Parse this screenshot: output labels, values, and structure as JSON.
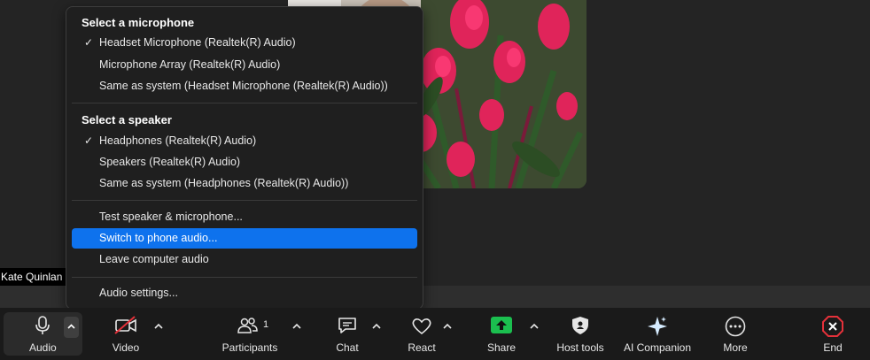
{
  "meeting": {
    "participant_name": "Kate Quinlan"
  },
  "audio_menu": {
    "microphone_header": "Select a microphone",
    "microphones": [
      {
        "label": "Headset Microphone (Realtek(R) Audio)",
        "checked": true
      },
      {
        "label": "Microphone Array (Realtek(R) Audio)",
        "checked": false
      },
      {
        "label": "Same as system (Headset Microphone (Realtek(R) Audio))",
        "checked": false
      }
    ],
    "speaker_header": "Select a speaker",
    "speakers": [
      {
        "label": "Headphones (Realtek(R) Audio)",
        "checked": true
      },
      {
        "label": "Speakers (Realtek(R) Audio)",
        "checked": false
      },
      {
        "label": "Same as system (Headphones (Realtek(R) Audio))",
        "checked": false
      }
    ],
    "actions": {
      "test": "Test speaker & microphone...",
      "phone": "Switch to phone audio...",
      "leave": "Leave computer audio"
    },
    "settings": "Audio settings...",
    "check_glyph": "✓",
    "highlight_color": "#0e72ed"
  },
  "toolbar": {
    "audio": "Audio",
    "video": "Video",
    "participants": "Participants",
    "participants_count": "1",
    "chat": "Chat",
    "react": "React",
    "share": "Share",
    "host_tools": "Host tools",
    "ai_companion": "AI Companion",
    "more": "More",
    "end": "End",
    "share_color": "#1bbf4f",
    "end_color": "#e5313a"
  }
}
